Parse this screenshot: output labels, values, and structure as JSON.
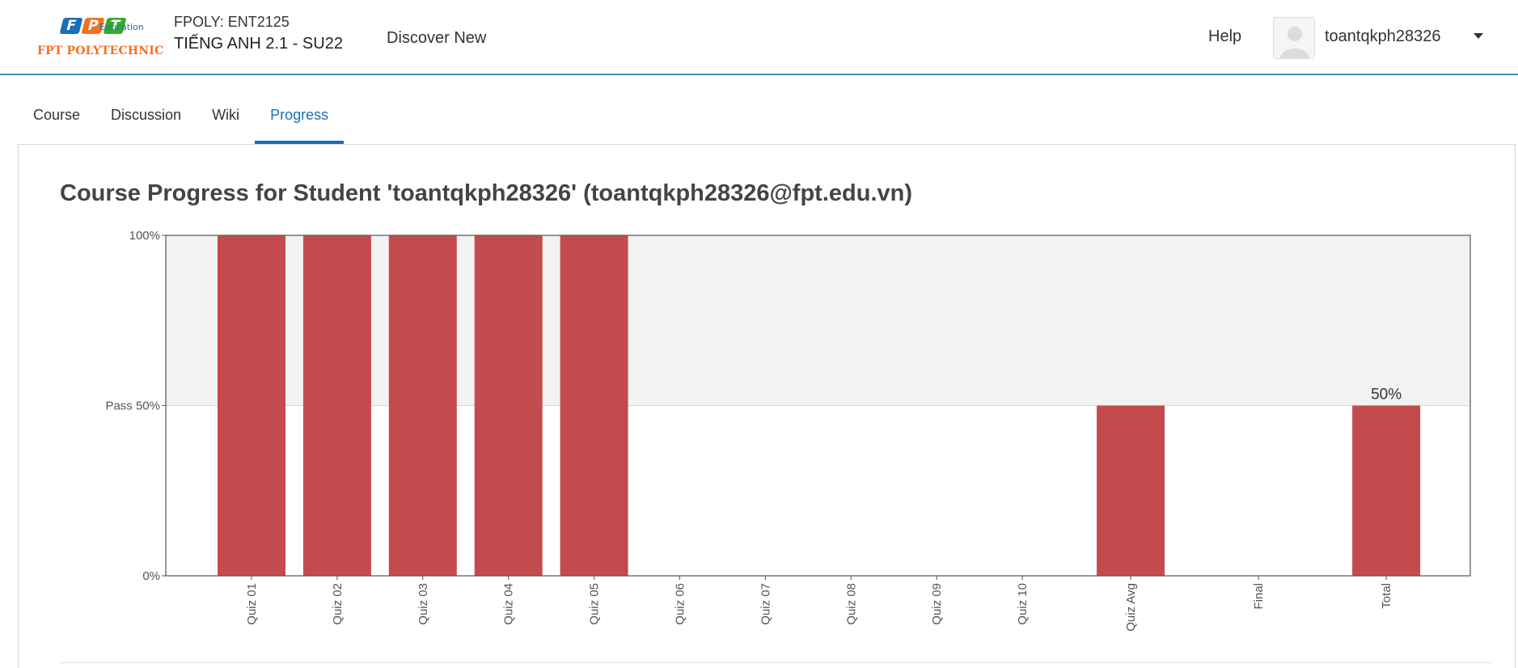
{
  "header": {
    "logo": {
      "marks": [
        {
          "letter": "F",
          "color": "#1b6fb8"
        },
        {
          "letter": "P",
          "color": "#f37021"
        },
        {
          "letter": "T",
          "color": "#3aa935"
        }
      ],
      "edu_text": "Education",
      "name": "FPT POLYTECHNIC"
    },
    "course_code": "FPOLY: ENT2125",
    "course_name": "TIẾNG ANH 2.1 - SU22",
    "discover_label": "Discover New",
    "help_label": "Help",
    "username": "toantqkph28326",
    "user_menu_icon": "caret-down-icon",
    "avatar_icon": "user-avatar-icon"
  },
  "tabs": [
    {
      "label": "Course",
      "active": false
    },
    {
      "label": "Discussion",
      "active": false
    },
    {
      "label": "Wiki",
      "active": false
    },
    {
      "label": "Progress",
      "active": true
    }
  ],
  "page_title": "Course Progress for Student 'toantqkph28326' (toantqkph28326@fpt.edu.vn)",
  "colors": {
    "accent": "#1b6fb8",
    "bar": "#c44b4d",
    "pass_region": "#f2f2f2"
  },
  "chart_data": {
    "type": "bar",
    "categories": [
      "Quiz 01",
      "Quiz 02",
      "Quiz 03",
      "Quiz 04",
      "Quiz 05",
      "Quiz 06",
      "Quiz 07",
      "Quiz 08",
      "Quiz 09",
      "Quiz 10",
      "Quiz Avg",
      "Final",
      "Total"
    ],
    "values": [
      100,
      100,
      100,
      100,
      100,
      0,
      0,
      0,
      0,
      0,
      50,
      0,
      50
    ],
    "ylim": [
      0,
      100
    ],
    "yticks": [
      {
        "value": 0,
        "label": "0%"
      },
      {
        "value": 50,
        "label": "Pass 50%"
      },
      {
        "value": 100,
        "label": "100%"
      }
    ],
    "pass_threshold": 50,
    "annotations": [
      {
        "category": "Total",
        "label": "50%"
      }
    ],
    "xlabel": "",
    "ylabel": "",
    "title": ""
  }
}
